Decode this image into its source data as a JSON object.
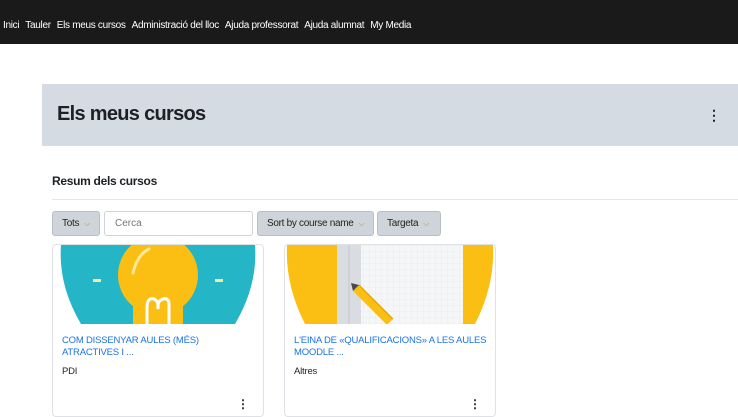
{
  "nav": {
    "items": [
      {
        "label": "Inici"
      },
      {
        "label": "Tauler"
      },
      {
        "label": "Els meus cursos",
        "active": true
      },
      {
        "label": "Administració del lloc"
      },
      {
        "label": "Ajuda professorat"
      },
      {
        "label": "Ajuda alumnat"
      },
      {
        "label": "My Media"
      }
    ]
  },
  "header": {
    "title": "Els meus cursos",
    "menu_icon": "kebab-icon"
  },
  "overview": {
    "title": "Resum dels cursos",
    "filter_label": "Tots",
    "search_placeholder": "Cerca",
    "sort_label": "Sort by course name",
    "view_label": "Targeta"
  },
  "courses": [
    {
      "title": "COM DISSENYAR AULES (MÉS) ATRACTIVES I ...",
      "category": "PDI",
      "image": "lightbulb-illustration"
    },
    {
      "title": "L'EINA DE «QUALIFICACIONS» A LES AULES MOODLE ...",
      "category": "Altres",
      "image": "pencil-notebook-illustration"
    }
  ],
  "colors": {
    "nav_bg": "#1a1a1a",
    "header_band": "#d5dbe3",
    "link": "#1a73e8",
    "teal": "#24b5c7",
    "yellow": "#fbbf13"
  }
}
